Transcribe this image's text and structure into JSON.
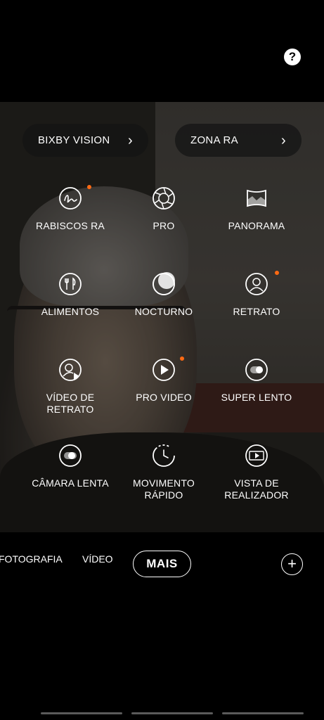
{
  "header": {
    "help_label": "?"
  },
  "quick_actions": [
    {
      "label": "BIXBY VISION",
      "chevron": "›"
    },
    {
      "label": "ZONA RA",
      "chevron": "›"
    }
  ],
  "modes": [
    {
      "label": "RABISCOS RA",
      "icon": "doodle-icon",
      "new_badge": true
    },
    {
      "label": "PRO",
      "icon": "aperture-icon",
      "new_badge": false
    },
    {
      "label": "PANORAMA",
      "icon": "panorama-icon",
      "new_badge": false
    },
    {
      "label": "ALIMENTOS",
      "icon": "food-icon",
      "new_badge": false
    },
    {
      "label": "NOCTURNO",
      "icon": "moon-icon",
      "new_badge": false
    },
    {
      "label": "RETRATO",
      "icon": "portrait-icon",
      "new_badge": true
    },
    {
      "label": "VÍDEO DE\nRETRATO",
      "icon": "portrait-video-icon",
      "new_badge": false
    },
    {
      "label": "PRO VIDEO",
      "icon": "play-icon",
      "new_badge": true
    },
    {
      "label": "SUPER LENTO",
      "icon": "super-slow-icon",
      "new_badge": false
    },
    {
      "label": "CÂMARA LENTA",
      "icon": "slow-motion-icon",
      "new_badge": false
    },
    {
      "label": "MOVIMENTO\nRÁPIDO",
      "icon": "hyperlapse-icon",
      "new_badge": false
    },
    {
      "label": "VISTA DE\nREALIZADOR",
      "icon": "directors-view-icon",
      "new_badge": false
    }
  ],
  "mode_bar": {
    "tabs": [
      "FOTOGRAFIA",
      "VÍDEO"
    ],
    "active": "MAIS",
    "add_label": "+"
  },
  "colors": {
    "badge": "#ff6a13",
    "pill_bg": "#141414",
    "background": "#000000"
  }
}
